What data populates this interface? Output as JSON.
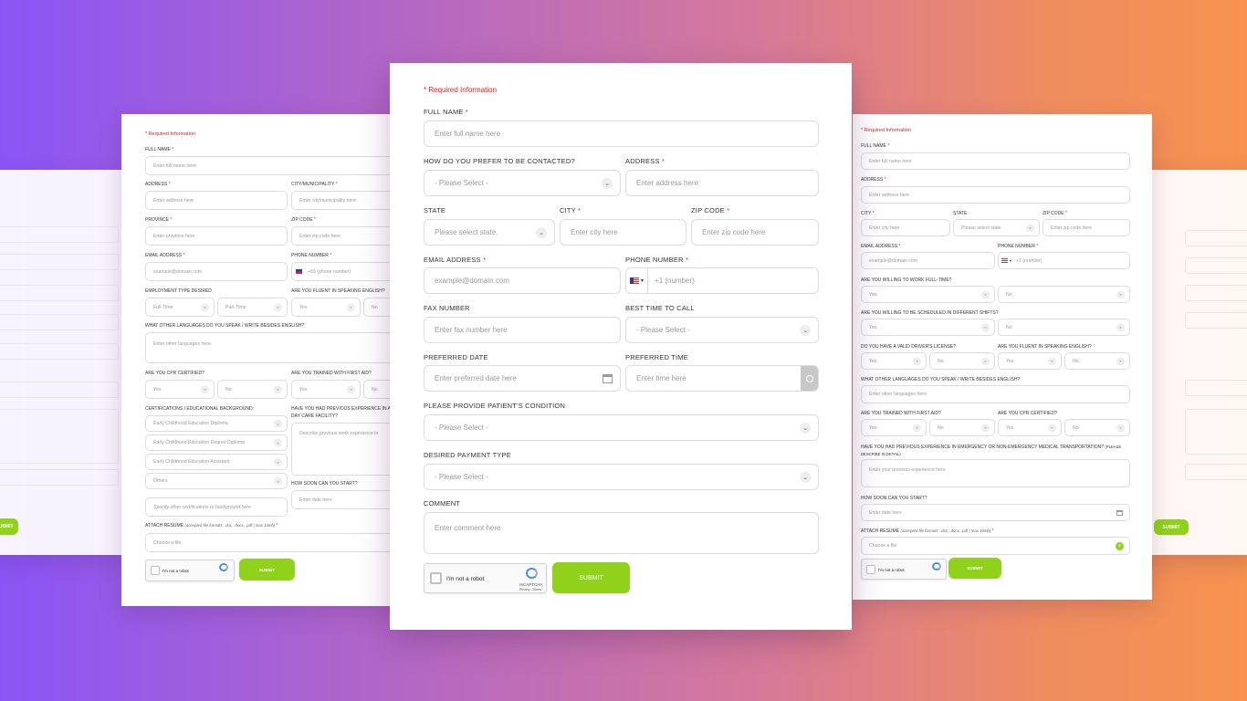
{
  "colors": {
    "accent_submit": "#8fd11b",
    "required_red": "#e02020",
    "background_gradient_start": "#8b55f6",
    "background_gradient_end": "#f7924f"
  },
  "main_form": {
    "required_info": "* Required Information",
    "full_name_label": "FULL NAME",
    "full_name_placeholder": "Enter full name here",
    "contact_pref_label": "HOW DO YOU PREFER TO BE CONTACTED?",
    "contact_pref_value": "- Please Select -",
    "address_label": "ADDRESS",
    "address_placeholder": "Enter address here",
    "state_label": "STATE",
    "state_value": "Please select state.",
    "city_label": "CITY",
    "city_placeholder": "Enter city here",
    "zip_label": "ZIP CODE",
    "zip_placeholder": "Enter zip code here",
    "email_label": "EMAIL ADDRESS",
    "email_placeholder": "example@domain.com",
    "phone_label": "PHONE NUMBER",
    "phone_placeholder": "+1 (number)",
    "fax_label": "FAX NUMBER",
    "fax_placeholder": "Enter fax number here",
    "best_time_label": "BEST TIME TO CALL",
    "best_time_value": "- Please Select -",
    "pref_date_label": "PREFERRED DATE",
    "pref_date_placeholder": "Enter preferred date here",
    "pref_time_label": "PREFERRED TIME",
    "pref_time_placeholder": "Enter time here",
    "condition_label": "PLEASE PROVIDE PATIENT'S CONDITION",
    "condition_value": "- Please Select -",
    "payment_label": "DESIRED PAYMENT TYPE",
    "payment_value": "- Please Select -",
    "comment_label": "COMMENT",
    "comment_placeholder": "Enter comment here",
    "captcha_text": "I'm not a robot",
    "captcha_brand": "reCAPTCHA",
    "captcha_terms": "Privacy - Terms",
    "submit_label": "SUBMIT"
  },
  "left_form": {
    "required_info": "* Required Information",
    "full_name_label": "FULL NAME",
    "full_name_placeholder": "Enter full name here",
    "address_label": "ADDRESS",
    "address_placeholder": "Enter address here",
    "city_label": "CITY/MUNICIPALITY",
    "city_placeholder": "Enter city/municipality here",
    "province_label": "PROVINCE",
    "province_placeholder": "Enter province here",
    "zip_label": "ZIP CODE",
    "zip_placeholder": "Enter zip code here",
    "email_label": "EMAIL ADDRESS",
    "email_placeholder": "example@domain.com",
    "phone_label": "PHONE NUMBER",
    "phone_placeholder": "+63 (phone number)",
    "employment_label": "EMPLOYMENT TYPE DESIRED",
    "full_time": "Full-Time",
    "part_time": "Part-Time",
    "english_label": "ARE YOU FLUENT IN SPEAKING ENGLISH?",
    "yes": "Yes",
    "no": "No",
    "languages_label": "WHAT OTHER LANGUAGES DO YOU SPEAK / WRITE BESIDES ENGLISH?",
    "languages_placeholder": "Enter other languages here",
    "cpr_label": "ARE YOU CPR CERTIFIED?",
    "first_aid_label": "ARE YOU TRAINED WITH FIRST AID?",
    "cert_label": "CERTIFICATIONS / EDUCATIONAL BACKGROUND:",
    "cert_option_1": "Early Childhood Education Diploma",
    "cert_option_2": "Early Childhood Education Degree Diploma",
    "cert_option_3": "Early Childhood Education Assistant",
    "cert_option_4": "Others",
    "cert_other_placeholder": "Specify other certifications or background here",
    "daycare_label_1": "HAVE YOU HAD PREVIOUS EXPERIENCE IN A",
    "daycare_label_2": "DAY CARE FACILITY?",
    "daycare_placeholder": "Describe previous work experience in",
    "start_label": "HOW SOON CAN YOU START?",
    "start_placeholder": "Enter date here",
    "resume_label": "ATTACH RESUME",
    "resume_note": "(accepted file formats: .doc, .docx, .pdf | max 10mb)",
    "resume_placeholder": "Choose a file",
    "captcha_text": "I'm not a robot",
    "submit_label": "SUBMIT"
  },
  "right_form": {
    "required_info": "* Required Information",
    "full_name_label": "FULL NAME",
    "full_name_placeholder": "Enter full name here",
    "address_label": "ADDRESS",
    "address_placeholder": "Enter address here",
    "city_label": "CITY",
    "city_placeholder": "Enter city here",
    "state_label": "STATE",
    "state_value": "Please select state.",
    "zip_label": "ZIP CODE",
    "zip_placeholder": "Enter zip code here",
    "email_label": "EMAIL ADDRESS",
    "email_placeholder": "example@domain.com",
    "phone_label": "PHONE NUMBER",
    "phone_placeholder": "+1 (number)",
    "full_time_label": "ARE YOU WILLING TO WORK FULL-TIME?",
    "shifts_label": "ARE YOU WILLING TO BE SCHEDULED IN DIFFERENT SHIFTS?",
    "license_label": "DO YOU HAVE A VALID DRIVER'S LICENSE?",
    "english_label": "ARE YOU FLUENT IN SPEAKING ENGLISH?",
    "yes": "Yes",
    "no": "No",
    "languages_label": "WHAT OTHER LANGUAGES DO YOU SPEAK / WRITE BESIDES ENGLISH?",
    "languages_placeholder": "Enter other languages here",
    "first_aid_label": "ARE YOU TRAINED WITH FIRST AID?",
    "cpr_label": "ARE YOU CPR CERTIFIED?",
    "experience_label": "HAVE YOU HAD PREVIOUS EXPERIENCE IN EMERGENCY OR NON-EMERGENCY MEDICAL TRANSPORTATION?",
    "experience_note": "(PLEASE DESCRIBE IN DETAIL)",
    "experience_placeholder": "Enter your previous experience here",
    "start_label": "HOW SOON CAN YOU START?",
    "start_placeholder": "Enter date here",
    "resume_label": "ATTACH RESUME",
    "resume_note": "(accepted file formats: .doc, .docx, .pdf | max 10mb)",
    "resume_placeholder": "Choose a file",
    "captcha_text": "I'm not a robot",
    "submit_label": "SUBMIT"
  },
  "back_left_form": {
    "submit_label": "SUBMIT"
  },
  "back_right_form": {
    "submit_label": "SUBMIT"
  }
}
